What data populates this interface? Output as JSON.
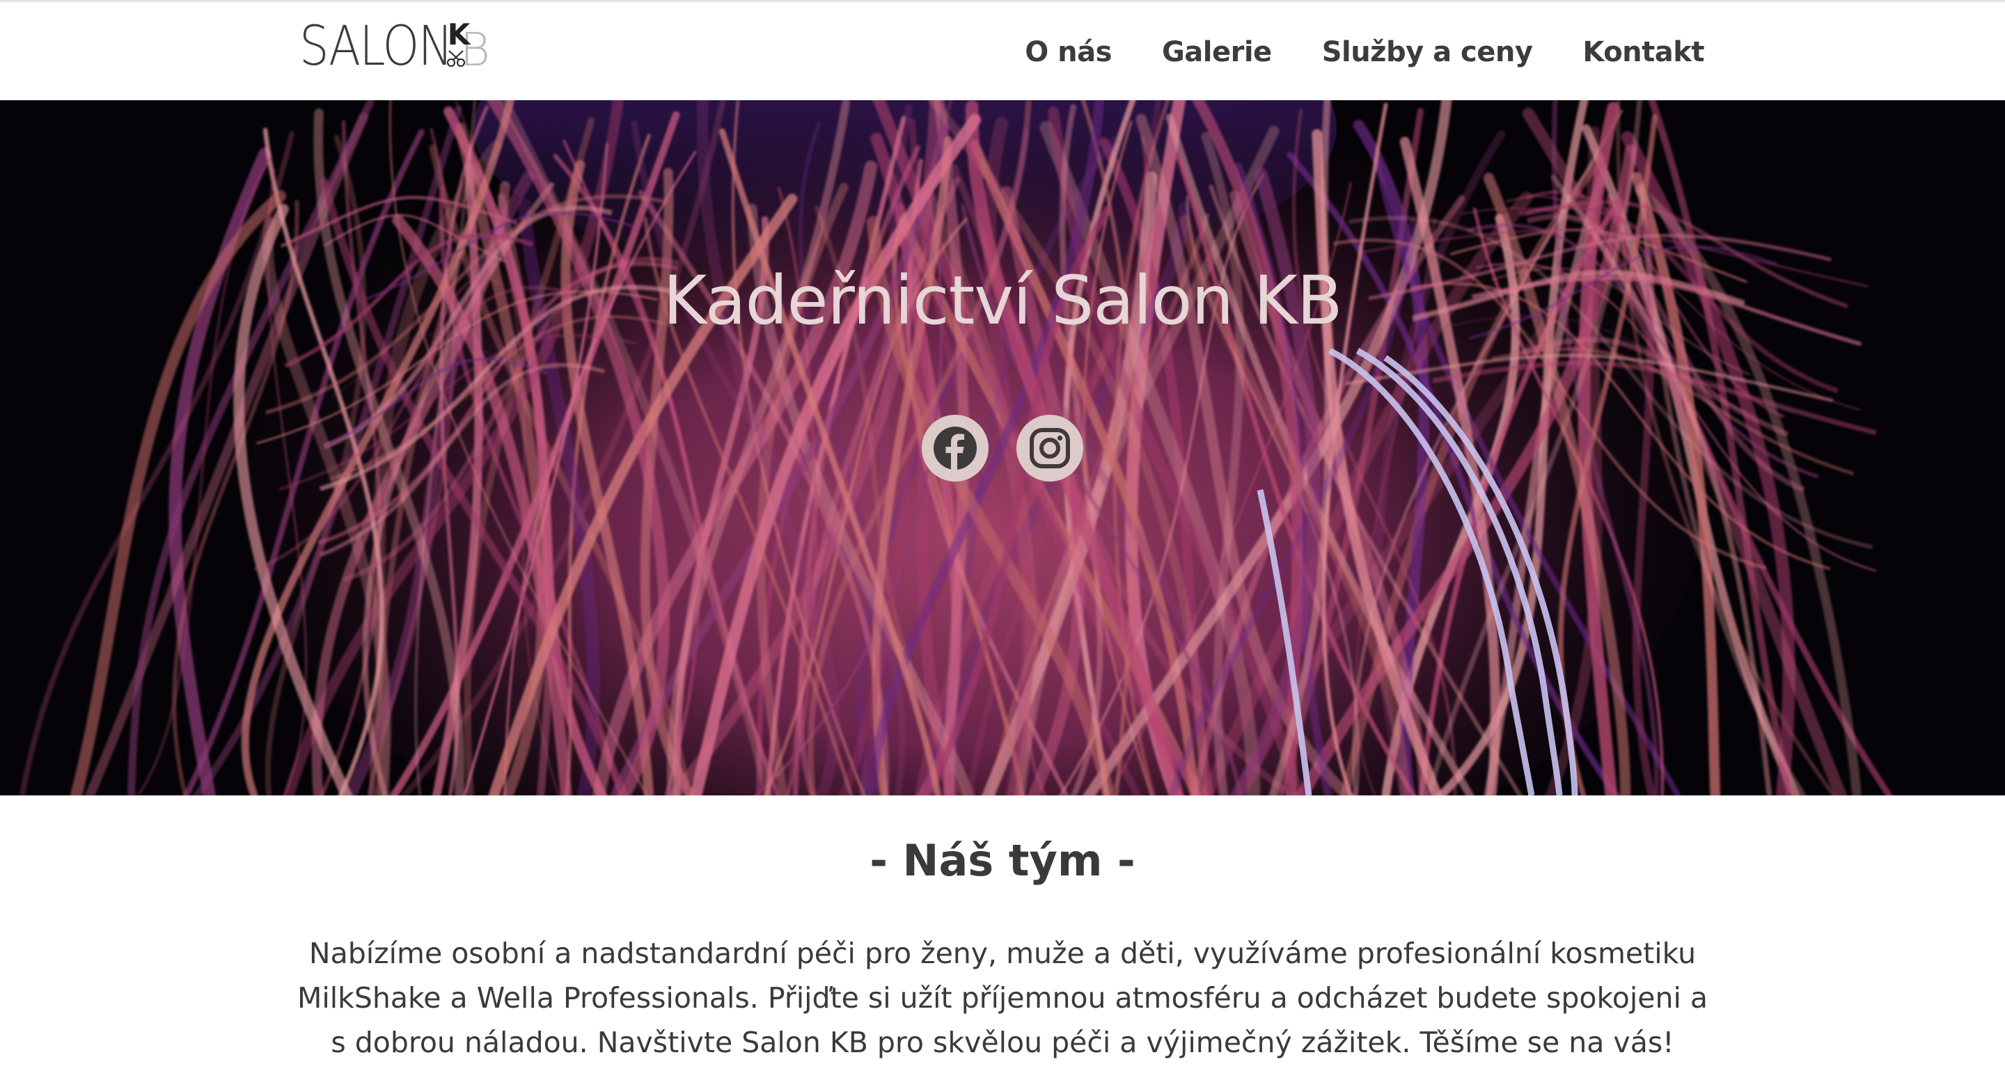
{
  "header": {
    "logo_text": "SALON",
    "logo_mark_k": "K",
    "logo_mark_b": "B",
    "nav": [
      {
        "label": "O nás"
      },
      {
        "label": "Galerie"
      },
      {
        "label": "Služby a ceny"
      },
      {
        "label": "Kontakt"
      }
    ]
  },
  "hero": {
    "title": "Kadeřnictví Salon KB",
    "socials": [
      {
        "icon": "facebook-icon"
      },
      {
        "icon": "instagram-icon"
      }
    ]
  },
  "team": {
    "title": "- Náš tým -",
    "text": "Nabízíme osobní a nadstandardní péči pro ženy, muže a děti, využíváme profesionální kosmetiku MilkShake a Wella Professionals. Přijďte si užít příjemnou atmosféru a odcházet budete spokojeni a s dobrou náladou. Navštivte Salon KB pro skvělou péči a výjimečný zážitek. Těšíme se na vás!"
  },
  "colors": {
    "hero_background": "#050307",
    "hair_pink": "#c0587a",
    "hair_purple": "#6a2a8a",
    "social_circle": "#dccbc8",
    "text": "#3a3a3a"
  }
}
